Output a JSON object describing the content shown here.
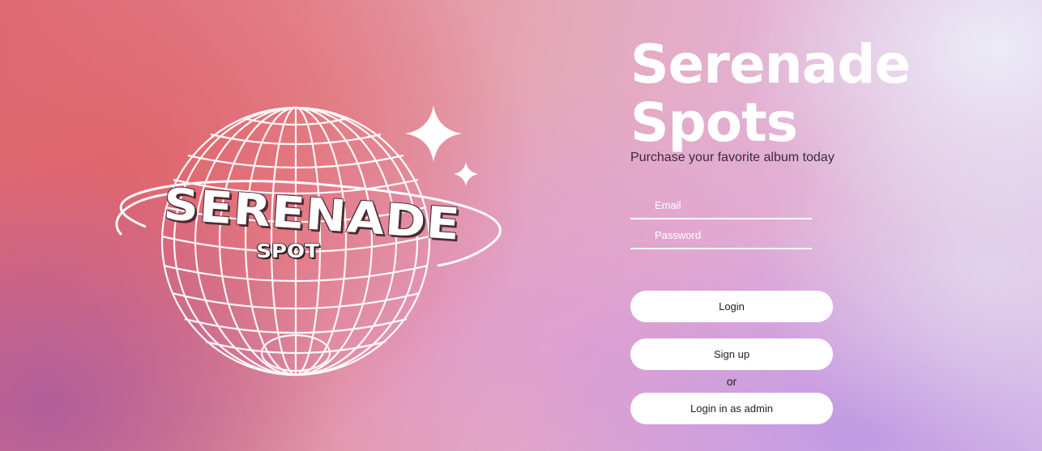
{
  "logo": {
    "word": "SERENADE",
    "sub": "SPOT"
  },
  "hero": {
    "title": "Serenade\nSpots",
    "subtitle": "Purchase your favorite album today"
  },
  "form": {
    "email_placeholder": "Email",
    "password_placeholder": "Password"
  },
  "actions": {
    "login_label": "Login",
    "signup_label": "Sign up",
    "or_label": "or",
    "admin_label": "Login in as admin"
  },
  "colors": {
    "background_left": "#de6c78",
    "background_right": "#ddc2e6",
    "button_bg": "#ffffff",
    "button_text": "#222222",
    "title_text": "#ffffff",
    "subtitle_text": "#3b2b3b"
  },
  "icons": {
    "logo_graphic": "disco-globe-icon",
    "sparkle": "sparkle-icon"
  }
}
